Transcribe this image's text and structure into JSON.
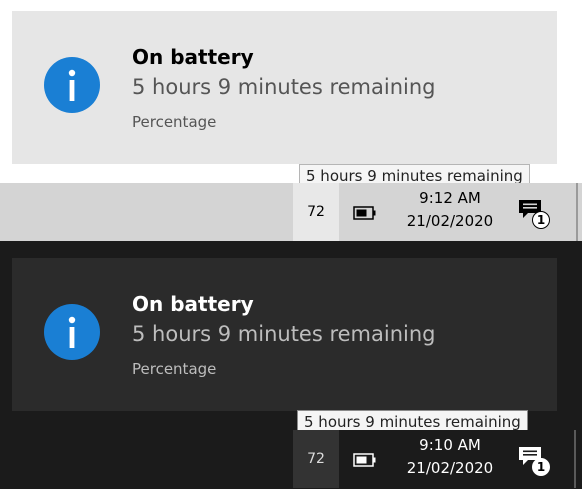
{
  "light": {
    "toast": {
      "title": "On battery",
      "body": "5 hours 9 minutes remaining",
      "action": "Percentage",
      "icon": "info-icon"
    },
    "tooltip": "5 hours 9 minutes remaining",
    "taskbar": {
      "battery_percent": "72",
      "time": "9:12 AM",
      "date": "21/02/2020",
      "notification_count": "1"
    }
  },
  "dark": {
    "toast": {
      "title": "On battery",
      "body": "5 hours 9 minutes remaining",
      "action": "Percentage",
      "icon": "info-icon"
    },
    "tooltip": "5 hours 9 minutes remaining",
    "taskbar": {
      "battery_percent": "72",
      "time": "9:10 AM",
      "date": "21/02/2020",
      "notification_count": "1"
    }
  },
  "colors": {
    "accent": "#1a7fd4",
    "light_toast_bg": "#e6e6e6",
    "light_taskbar_bg": "#d4d4d4",
    "dark_toast_bg": "#2b2b2b",
    "dark_taskbar_bg": "#1b1b1b"
  }
}
